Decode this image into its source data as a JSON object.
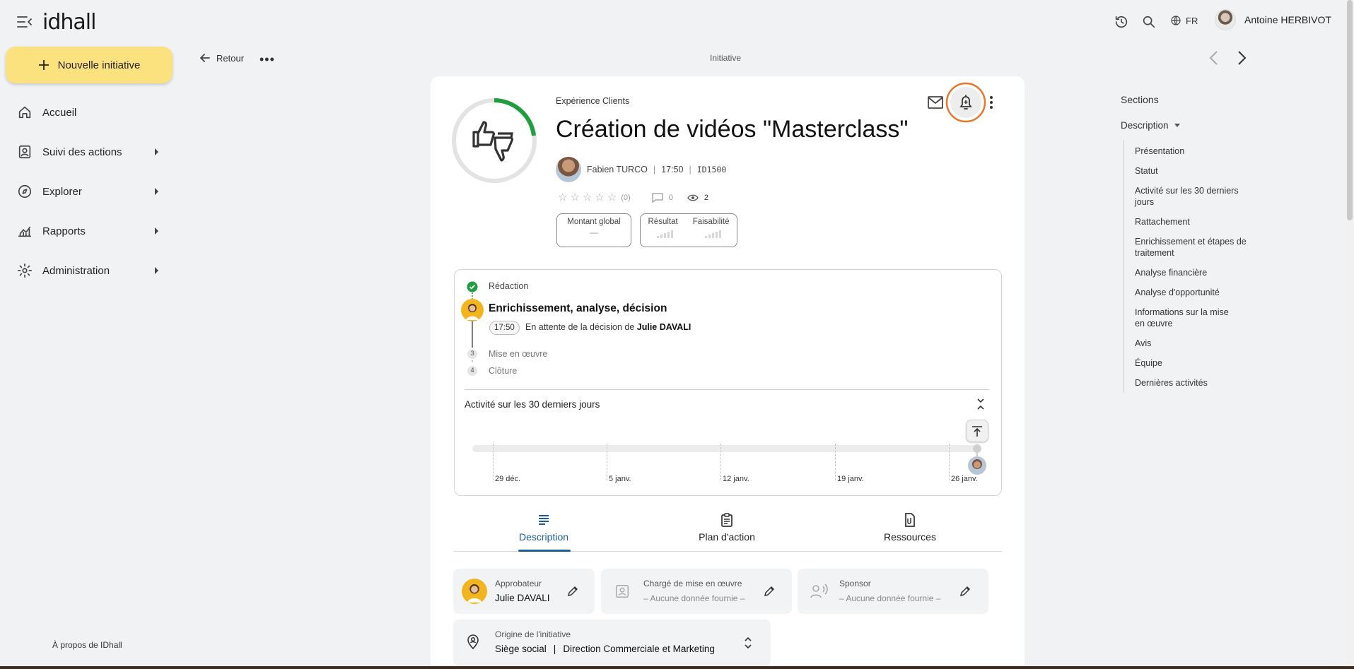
{
  "app": {
    "logo": "idhall",
    "logo_left": "id",
    "logo_right": "hall"
  },
  "header": {
    "language": "FR",
    "user_name": "Antoine HERBIVOT",
    "icons": [
      "history-icon",
      "search-icon",
      "globe-icon"
    ]
  },
  "sidebar": {
    "new_button": "Nouvelle initiative",
    "items": [
      {
        "label": "Accueil",
        "icon": "home-icon"
      },
      {
        "label": "Suivi des actions",
        "icon": "clipboard-user-icon"
      },
      {
        "label": "Explorer",
        "icon": "compass-icon"
      },
      {
        "label": "Rapports",
        "icon": "chart-icon"
      },
      {
        "label": "Administration",
        "icon": "gear-icon"
      }
    ],
    "about": "À propos de IDhall"
  },
  "subheader": {
    "back_label": "Retour",
    "more": "•••",
    "breadcrumb": "Initiative"
  },
  "initiative": {
    "category": "Expérience Clients",
    "title": "Création de vidéos \"Masterclass\"",
    "author": "Fabien TURCO",
    "time": "17:50",
    "id": "ID1500",
    "rating_count": "(0)",
    "comments": "0",
    "views": "2",
    "amount_label": "Montant global",
    "amount_value": "—",
    "result_label": "Résultat",
    "feasibility_label": "Faisabilité"
  },
  "process": {
    "step1": "Rédaction",
    "current": "Enrichissement, analyse, décision",
    "current_time": "17:50",
    "waiting_text": "En attente de la décision de",
    "waiting_person": "Julie DAVALI",
    "step3_num": "3",
    "step3": "Mise en œuvre",
    "step4_num": "4",
    "step4": "Clôture",
    "activity_title": "Activité sur les 30 derniers jours",
    "dates": [
      "29 déc.",
      "5 janv.",
      "12 janv.",
      "19 janv.",
      "26 janv."
    ]
  },
  "tabs": [
    {
      "label": "Description",
      "active": true
    },
    {
      "label": "Plan d'action",
      "active": false
    },
    {
      "label": "Ressources",
      "active": false
    }
  ],
  "fields": {
    "approver_label": "Approbateur",
    "approver_value": "Julie DAVALI",
    "manager_label": "Chargé de mise en œuvre",
    "manager_value": "– Aucune donnée fournie –",
    "sponsor_label": "Sponsor",
    "sponsor_value": "– Aucune donnée fournie –",
    "origin_label": "Origine de l'initiative",
    "origin_site": "Siège social",
    "origin_sep": "|",
    "origin_dept": "Direction Commerciale et Marketing"
  },
  "sections": {
    "title": "Sections",
    "group": "Description",
    "items": [
      "Présentation",
      "Statut",
      "Activité sur les 30 derniers jours",
      "Rattachement",
      "Enrichissement et étapes de traitement",
      "Analyse financière",
      "Analyse d'opportunité",
      "Informations sur la mise en œuvre",
      "Avis",
      "Équipe",
      "Dernières activités"
    ]
  },
  "colors": {
    "accent": "#1b5e99",
    "new_button": "#fbe27f",
    "highlight_ring": "#e8762c",
    "progress_green": "#1f9d3f"
  }
}
